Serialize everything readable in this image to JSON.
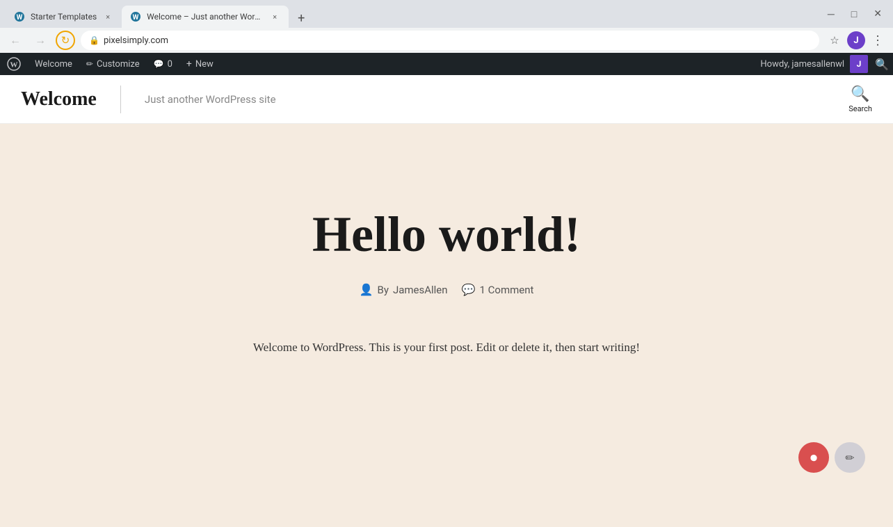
{
  "browser": {
    "tabs": [
      {
        "id": "tab1",
        "favicon": "wp",
        "title": "Starter Templates",
        "active": false,
        "closeable": true
      },
      {
        "id": "tab2",
        "favicon": "wp",
        "title": "Welcome – Just another WordPr...",
        "active": true,
        "closeable": true
      }
    ],
    "new_tab_label": "+",
    "url": "pixelsimply.com",
    "nav": {
      "back_disabled": true,
      "forward_disabled": true
    }
  },
  "wp_admin_bar": {
    "wp_logo_title": "WordPress",
    "items": [
      {
        "id": "welcome",
        "label": "Welcome"
      },
      {
        "id": "customize",
        "label": "Customize",
        "icon": "pencil"
      },
      {
        "id": "comments",
        "label": "0",
        "icon": "comment"
      },
      {
        "id": "new",
        "label": "New",
        "icon": "plus"
      }
    ],
    "howdy_text": "Howdy, jamesallenwl",
    "avatar_initials": "J"
  },
  "site_header": {
    "title": "Welcome",
    "tagline": "Just another WordPress site",
    "search_label": "Search"
  },
  "post": {
    "title": "Hello world!",
    "meta": {
      "author_prefix": "By",
      "author": "JamesAllen",
      "comments": "1 Comment"
    },
    "body": "Welcome to WordPress. This is your first post. Edit or delete it, then start writing!"
  },
  "floating": {
    "record_icon": "⏺",
    "edit_icon": "✏"
  }
}
